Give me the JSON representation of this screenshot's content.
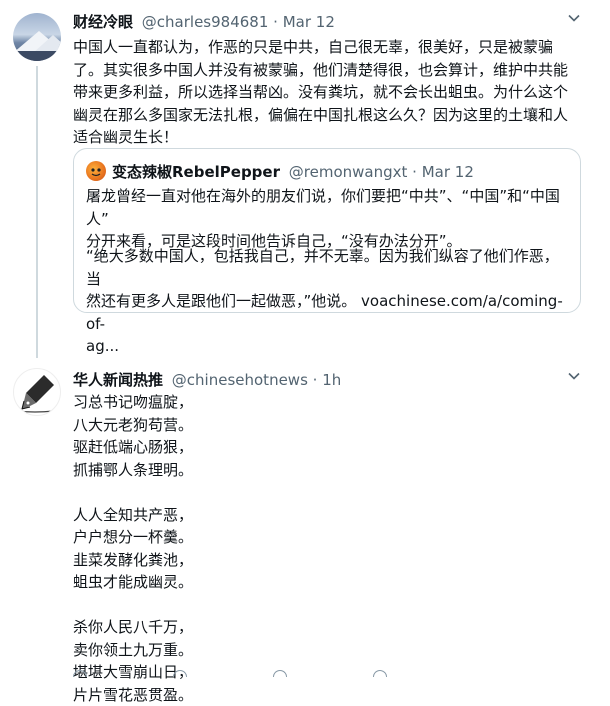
{
  "tweet1": {
    "display_name": "财经冷眼",
    "handle": "@charles984681",
    "separator": "·",
    "date": "Mar 12",
    "text_lines": [
      "中国人一直都认为，作恶的只是中共，自己很无辜，很美好，只是被蒙骗",
      "了。其实很多中国人并没有被蒙骗，他们清楚得很，也会算计，维护中共能",
      "带来更多利益，所以选择当帮凶。没有粪坑，就不会长出蛆虫。为什么这个",
      "幽灵在那么多国家无法扎根，偏偏在中国扎根这么久？因为这里的土壤和人",
      "适合幽灵生长！"
    ],
    "menu_icon": "chevron-down-icon"
  },
  "quoted": {
    "display_name": "变态辣椒RebelPepper",
    "handle": "@remonwangxt",
    "separator": "·",
    "date": "Mar 12",
    "para1_lines": [
      "屠龙曾经一直对他在海外的朋友们说，你们要把“中共”、“中国”和“中国人”",
      "分开来看，可是这段时间他告诉自己，“没有办法分开”。"
    ],
    "para2_lines": [
      "“绝大多数中国人，包括我自己，并不无辜。因为我们纵容了他们作恶，当",
      "然还有更多人是跟他们一起做恶，”他说。 voachinese.com/a/coming-of-",
      "ag..."
    ]
  },
  "tweet2": {
    "display_name": "华人新闻热推",
    "handle": "@chinesehotnews",
    "separator": "·",
    "time": "1h",
    "stanza1": [
      "习总书记吻瘟腚，",
      "八大元老狗苟营。",
      "驱赶低端心肠狠，",
      "抓捕鄂人条理明。"
    ],
    "stanza2": [
      "人人全知共产恶，",
      "户户想分一杯羹。",
      "韭菜发酵化粪池，",
      "蛆虫才能成幽灵。"
    ],
    "stanza3": [
      "杀你人民八千万，",
      "卖你领土九万重。",
      "堪堪大雪崩山日，",
      "片片雪花恶贯盈。"
    ],
    "menu_icon": "chevron-down-icon"
  },
  "colors": {
    "text": "#0f1419",
    "secondary": "#536471",
    "border": "#cfd9de"
  }
}
